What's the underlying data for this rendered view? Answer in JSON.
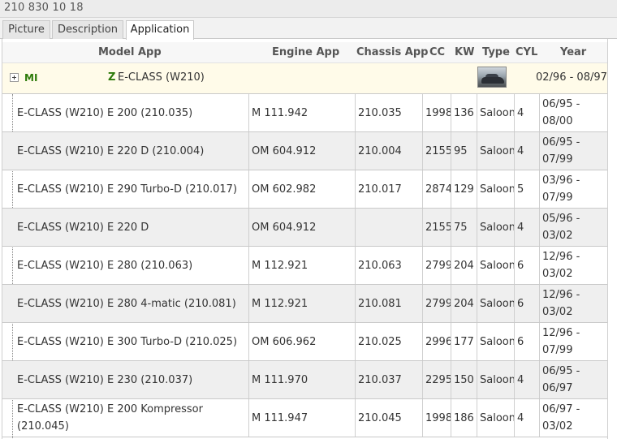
{
  "part_number": "210 830 10 18",
  "tabs": [
    {
      "label": "Picture",
      "active": false
    },
    {
      "label": "Description",
      "active": false
    },
    {
      "label": "Application",
      "active": true
    }
  ],
  "table": {
    "headers": {
      "model": "Model App",
      "engine": "Engine App",
      "chassis": "Chassis App",
      "cc": "CC",
      "kw": "KW",
      "type": "Type",
      "cyl": "CYL",
      "year": "Year"
    },
    "group": {
      "manufacturer_code": "MI",
      "model_letter": "Z",
      "name": "E-CLASS (W210)",
      "years": "02/96 - 08/97",
      "image_icon": "car-photo"
    },
    "rows": [
      {
        "model": "E-CLASS (W210) E 200 (210.035)",
        "engine": "M 111.942",
        "chassis": "210.035",
        "cc": "1998",
        "kw": "136",
        "type": "Saloon",
        "cyl": "4",
        "year": "06/95 - 08/00"
      },
      {
        "model": "E-CLASS (W210) E 220 D (210.004)",
        "engine": "OM 604.912",
        "chassis": "210.004",
        "cc": "2155",
        "kw": "95",
        "type": "Saloon",
        "cyl": "4",
        "year": "06/95 - 07/99"
      },
      {
        "model": "E-CLASS (W210) E 290 Turbo-D (210.017)",
        "engine": "OM 602.982",
        "chassis": "210.017",
        "cc": "2874",
        "kw": "129",
        "type": "Saloon",
        "cyl": "5",
        "year": "03/96 - 07/99"
      },
      {
        "model": "E-CLASS (W210) E 220 D",
        "engine": "OM 604.912",
        "chassis": "",
        "cc": "2155",
        "kw": "75",
        "type": "Saloon",
        "cyl": "4",
        "year": "05/96 - 03/02"
      },
      {
        "model": "E-CLASS (W210) E 280 (210.063)",
        "engine": "M 112.921",
        "chassis": "210.063",
        "cc": "2799",
        "kw": "204",
        "type": "Saloon",
        "cyl": "6",
        "year": "12/96 - 03/02"
      },
      {
        "model": "E-CLASS (W210) E 280 4-matic (210.081)",
        "engine": "M 112.921",
        "chassis": "210.081",
        "cc": "2799",
        "kw": "204",
        "type": "Saloon",
        "cyl": "6",
        "year": "12/96 - 03/02"
      },
      {
        "model": "E-CLASS (W210) E 300 Turbo-D (210.025)",
        "engine": "OM 606.962",
        "chassis": "210.025",
        "cc": "2996",
        "kw": "177",
        "type": "Saloon",
        "cyl": "6",
        "year": "12/96 - 07/99"
      },
      {
        "model": "E-CLASS (W210) E 230 (210.037)",
        "engine": "M 111.970",
        "chassis": "210.037",
        "cc": "2295",
        "kw": "150",
        "type": "Saloon",
        "cyl": "4",
        "year": "06/95 - 06/97"
      },
      {
        "model": "E-CLASS (W210) E 200 Kompressor (210.045)",
        "engine": "M 111.947",
        "chassis": "210.045",
        "cc": "1998",
        "kw": "186",
        "type": "Saloon",
        "cyl": "4",
        "year": "06/97 - 03/02"
      }
    ]
  }
}
